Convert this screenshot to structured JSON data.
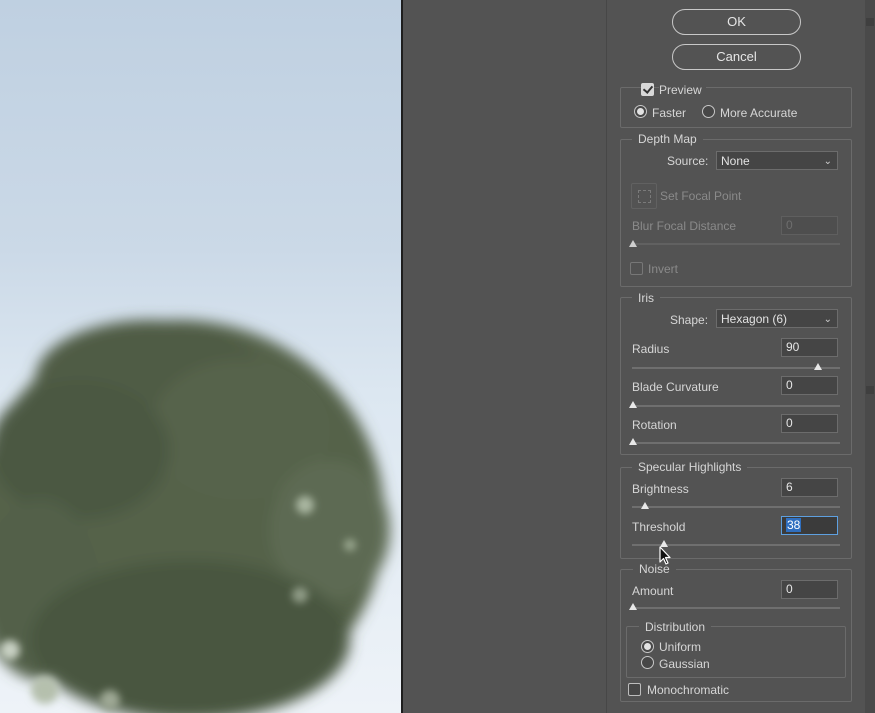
{
  "buttons": {
    "ok_label": "OK",
    "cancel_label": "Cancel"
  },
  "preview": {
    "checkbox_label": "Preview",
    "checked": true,
    "faster_label": "Faster",
    "accurate_label": "More Accurate",
    "selected": "Faster"
  },
  "depth_map": {
    "title": "Depth Map",
    "source_label": "Source:",
    "source_value": "None",
    "set_focal_label": "Set Focal Point",
    "blur_focal_label": "Blur Focal Distance",
    "blur_focal_value": "0",
    "invert_label": "Invert"
  },
  "iris": {
    "title": "Iris",
    "shape_label": "Shape:",
    "shape_value": "Hexagon (6)",
    "radius_label": "Radius",
    "radius_value": "90",
    "radius_fraction": 0.9,
    "blade_label": "Blade Curvature",
    "blade_value": "0",
    "blade_fraction": 0,
    "rotation_label": "Rotation",
    "rotation_value": "0",
    "rotation_fraction": 0
  },
  "specular": {
    "title": "Specular Highlights",
    "brightness_label": "Brightness",
    "brightness_value": "6",
    "brightness_fraction": 0.06,
    "threshold_label": "Threshold",
    "threshold_value": "38",
    "threshold_fraction": 0.15
  },
  "noise": {
    "title": "Noise",
    "amount_label": "Amount",
    "amount_value": "0",
    "amount_fraction": 0,
    "distribution_title": "Distribution",
    "uniform_label": "Uniform",
    "gaussian_label": "Gaussian",
    "selected": "Uniform",
    "mono_label": "Monochromatic"
  },
  "icons": [
    "chevron-down-icon",
    "focal-point-icon",
    "mouse-cursor-icon"
  ],
  "colors": {
    "panel_bg": "#535353",
    "focus_blue": "#5ea0e0",
    "selection_blue": "#2f6fc0"
  }
}
